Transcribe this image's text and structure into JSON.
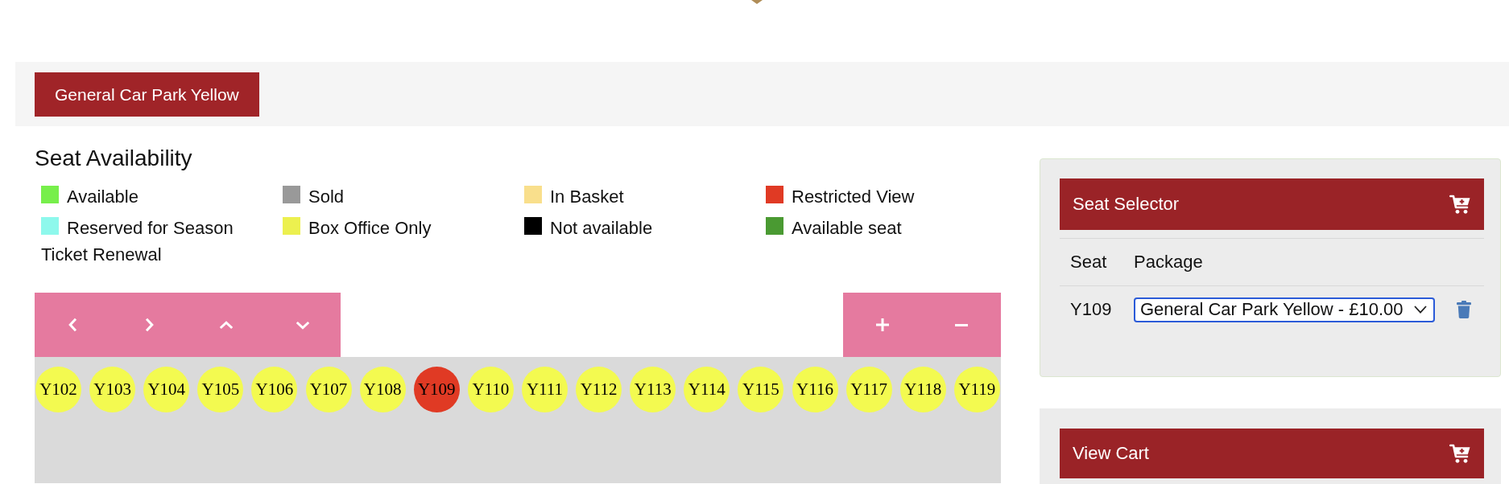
{
  "tabs": [
    {
      "label": "General Car Park Yellow",
      "selected": true
    }
  ],
  "legend": {
    "title": "Seat Availability",
    "items": [
      {
        "label": "Available",
        "color": "#77ef4b"
      },
      {
        "label": "Sold",
        "color": "#999999"
      },
      {
        "label": "In Basket",
        "color": "#f9df8c"
      },
      {
        "label": "Restricted View",
        "color": "#e03a24"
      },
      {
        "label": "Reserved for Season Ticket Renewal",
        "color": "#8ef8ec"
      },
      {
        "label": "Box Office Only",
        "color": "#ecf04f"
      },
      {
        "label": "Not available",
        "color": "#000000"
      },
      {
        "label": "Available seat",
        "color": "#4a9a32"
      }
    ]
  },
  "controls": {
    "pan": [
      {
        "kind": "left"
      },
      {
        "kind": "right"
      },
      {
        "kind": "up"
      },
      {
        "kind": "down"
      }
    ],
    "zoom": [
      {
        "kind": "zoom-in"
      },
      {
        "kind": "zoom-out"
      }
    ]
  },
  "seat_map": {
    "seats": [
      {
        "label": "Y102",
        "color": "#f3fa50"
      },
      {
        "label": "Y103",
        "color": "#f3fa50"
      },
      {
        "label": "Y104",
        "color": "#f3fa50"
      },
      {
        "label": "Y105",
        "color": "#f3fa50"
      },
      {
        "label": "Y106",
        "color": "#f3fa50"
      },
      {
        "label": "Y107",
        "color": "#f3fa50"
      },
      {
        "label": "Y108",
        "color": "#f3fa50"
      },
      {
        "label": "Y109",
        "color": "#e03a24"
      },
      {
        "label": "Y110",
        "color": "#f3fa50"
      },
      {
        "label": "Y111",
        "color": "#f3fa50"
      },
      {
        "label": "Y112",
        "color": "#f3fa50"
      },
      {
        "label": "Y113",
        "color": "#f3fa50"
      },
      {
        "label": "Y114",
        "color": "#f3fa50"
      },
      {
        "label": "Y115",
        "color": "#f3fa50"
      },
      {
        "label": "Y116",
        "color": "#f3fa50"
      },
      {
        "label": "Y117",
        "color": "#f3fa50"
      },
      {
        "label": "Y118",
        "color": "#f3fa50"
      },
      {
        "label": "Y119",
        "color": "#f3fa50"
      }
    ]
  },
  "seat_selector": {
    "title": "Seat Selector",
    "columns": [
      "Seat",
      "Package"
    ],
    "rows": [
      {
        "seat": "Y109",
        "package": "General Car Park Yellow - £10.00"
      }
    ]
  },
  "cart": {
    "title": "View Cart"
  }
}
